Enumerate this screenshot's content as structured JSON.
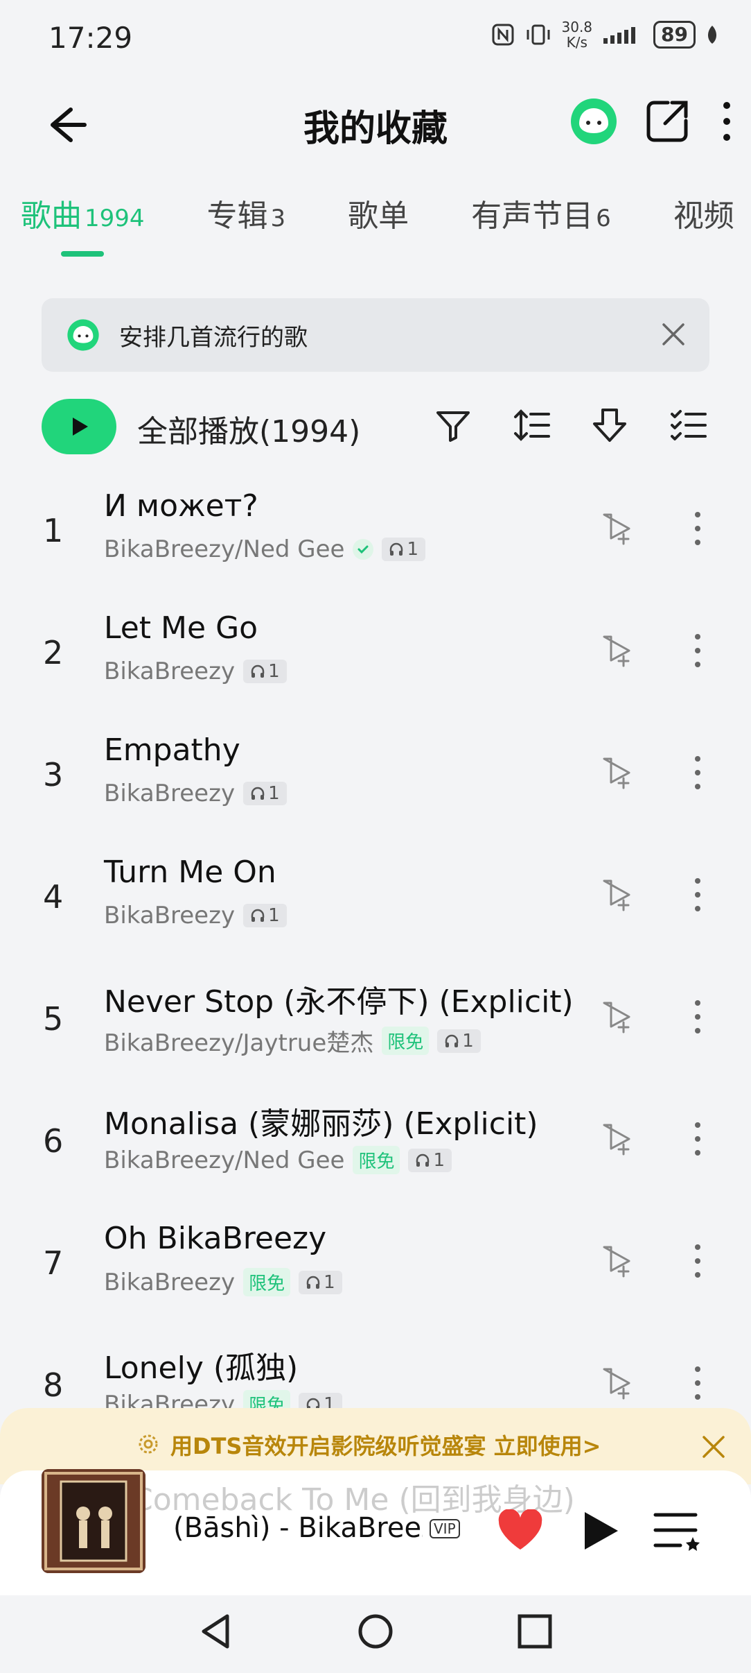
{
  "status_bar": {
    "time": "17:29",
    "net_speed_top": "30.8",
    "net_speed_unit": "K/s",
    "battery": "89"
  },
  "header": {
    "title": "我的收藏"
  },
  "tabs": [
    {
      "label": "歌曲",
      "count": "1994"
    },
    {
      "label": "专辑",
      "count": "3"
    },
    {
      "label": "歌单",
      "count": ""
    },
    {
      "label": "有声节目",
      "count": "6"
    },
    {
      "label": "视频",
      "count": ""
    }
  ],
  "banner": {
    "text": "安排几首流行的歌"
  },
  "play_all": {
    "label": "全部播放(1994)"
  },
  "songs": [
    {
      "num": "1",
      "title": "И может?",
      "artist": "BikaBreezy/Ned Gee",
      "free": "",
      "plays": "1"
    },
    {
      "num": "2",
      "title": "Let Me Go",
      "artist": "BikaBreezy",
      "free": "",
      "plays": "1"
    },
    {
      "num": "3",
      "title": "Empathy",
      "artist": "BikaBreezy",
      "free": "",
      "plays": "1"
    },
    {
      "num": "4",
      "title": "Turn Me On",
      "artist": "BikaBreezy",
      "free": "",
      "plays": "1"
    },
    {
      "num": "5",
      "title": "Never Stop (永不停下) (Explicit)",
      "artist": "BikaBreezy/Jaytrue楚杰",
      "free": "限免",
      "plays": "1"
    },
    {
      "num": "6",
      "title": "Monalisa (蒙娜丽莎) (Explicit)",
      "artist": "BikaBreezy/Ned Gee",
      "free": "限免",
      "plays": "1"
    },
    {
      "num": "7",
      "title": "Oh BikaBreezy",
      "artist": "BikaBreezy",
      "free": "限免",
      "plays": "1"
    },
    {
      "num": "8",
      "title": "Lonely (孤独)",
      "artist": "BikaBreezy",
      "free": "限免",
      "plays": "1"
    }
  ],
  "promo": {
    "text": "用DTS音效开启影院级听觉盛宴  立即使用>"
  },
  "player": {
    "ghost_title": "Comeback To Me (回到我身边)",
    "now_playing": "(Bāshì) - BikaBreezy",
    "vip_label": "VIP"
  },
  "colors": {
    "accent": "#1ec27a",
    "heart": "#ef3b3b",
    "promo_text": "#b8860b"
  }
}
